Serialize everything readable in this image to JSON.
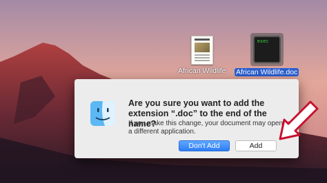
{
  "desktop": {
    "files": [
      {
        "label": "African Wildlife",
        "icon": "document-thumbnail-icon"
      },
      {
        "label": "African Wildlife.doc",
        "icon": "exec-terminal-icon",
        "icon_text": "exec",
        "selected": true
      }
    ]
  },
  "dialog": {
    "title": "Are you sure you want to add the extension “.doc” to the end of the name?",
    "message": "If you make this change, your document may open in a different application.",
    "icon": "finder-icon",
    "buttons": {
      "dont_add": "Don't Add",
      "add": "Add"
    }
  },
  "overlay": {
    "pointer": "arrow-pointer-icon"
  },
  "colors": {
    "accent": "#2e7cf6",
    "dialog_bg": "#ececec",
    "selection": "#2a5fd0"
  }
}
